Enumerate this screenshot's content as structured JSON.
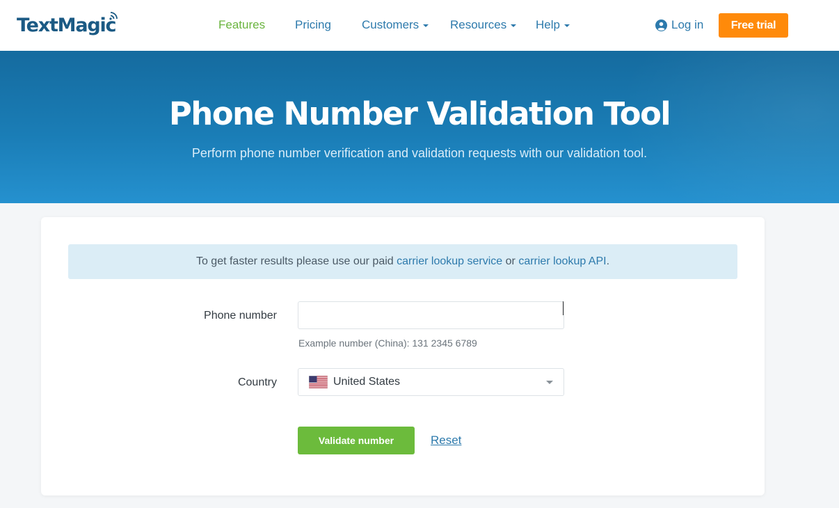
{
  "brand": {
    "name": "TextMagic"
  },
  "nav": {
    "items": [
      {
        "label": "Features",
        "active": true,
        "dropdown": false
      },
      {
        "label": "Pricing",
        "active": false,
        "dropdown": false
      },
      {
        "label": "Customers",
        "active": false,
        "dropdown": true
      },
      {
        "label": "Resources",
        "active": false,
        "dropdown": true
      },
      {
        "label": "Help",
        "active": false,
        "dropdown": true
      }
    ],
    "login_label": "Log in",
    "trial_label": "Free trial"
  },
  "hero": {
    "title": "Phone Number Validation Tool",
    "subtitle": "Perform phone number verification and validation requests with our validation tool."
  },
  "notice": {
    "prefix": "To get faster results please use our paid ",
    "link1": "carrier lookup service",
    "middle": " or ",
    "link2": "carrier lookup API",
    "suffix": "."
  },
  "form": {
    "phone_label": "Phone number",
    "phone_value": "",
    "example_text": "Example number (China): 131 2345 6789",
    "country_label": "Country",
    "country_value": "United States",
    "validate_label": "Validate number",
    "reset_label": "Reset"
  },
  "colors": {
    "brand_blue": "#1b5a84",
    "link_blue": "#2d7aac",
    "active_green": "#6ab43e",
    "trial_orange": "#ff8a0a",
    "validate_green": "#6cbb3c"
  },
  "icons": {
    "signal": "signal-waves-icon",
    "user": "user-circle-icon",
    "flag": "us-flag-icon",
    "dropdown": "chevron-down-icon"
  }
}
